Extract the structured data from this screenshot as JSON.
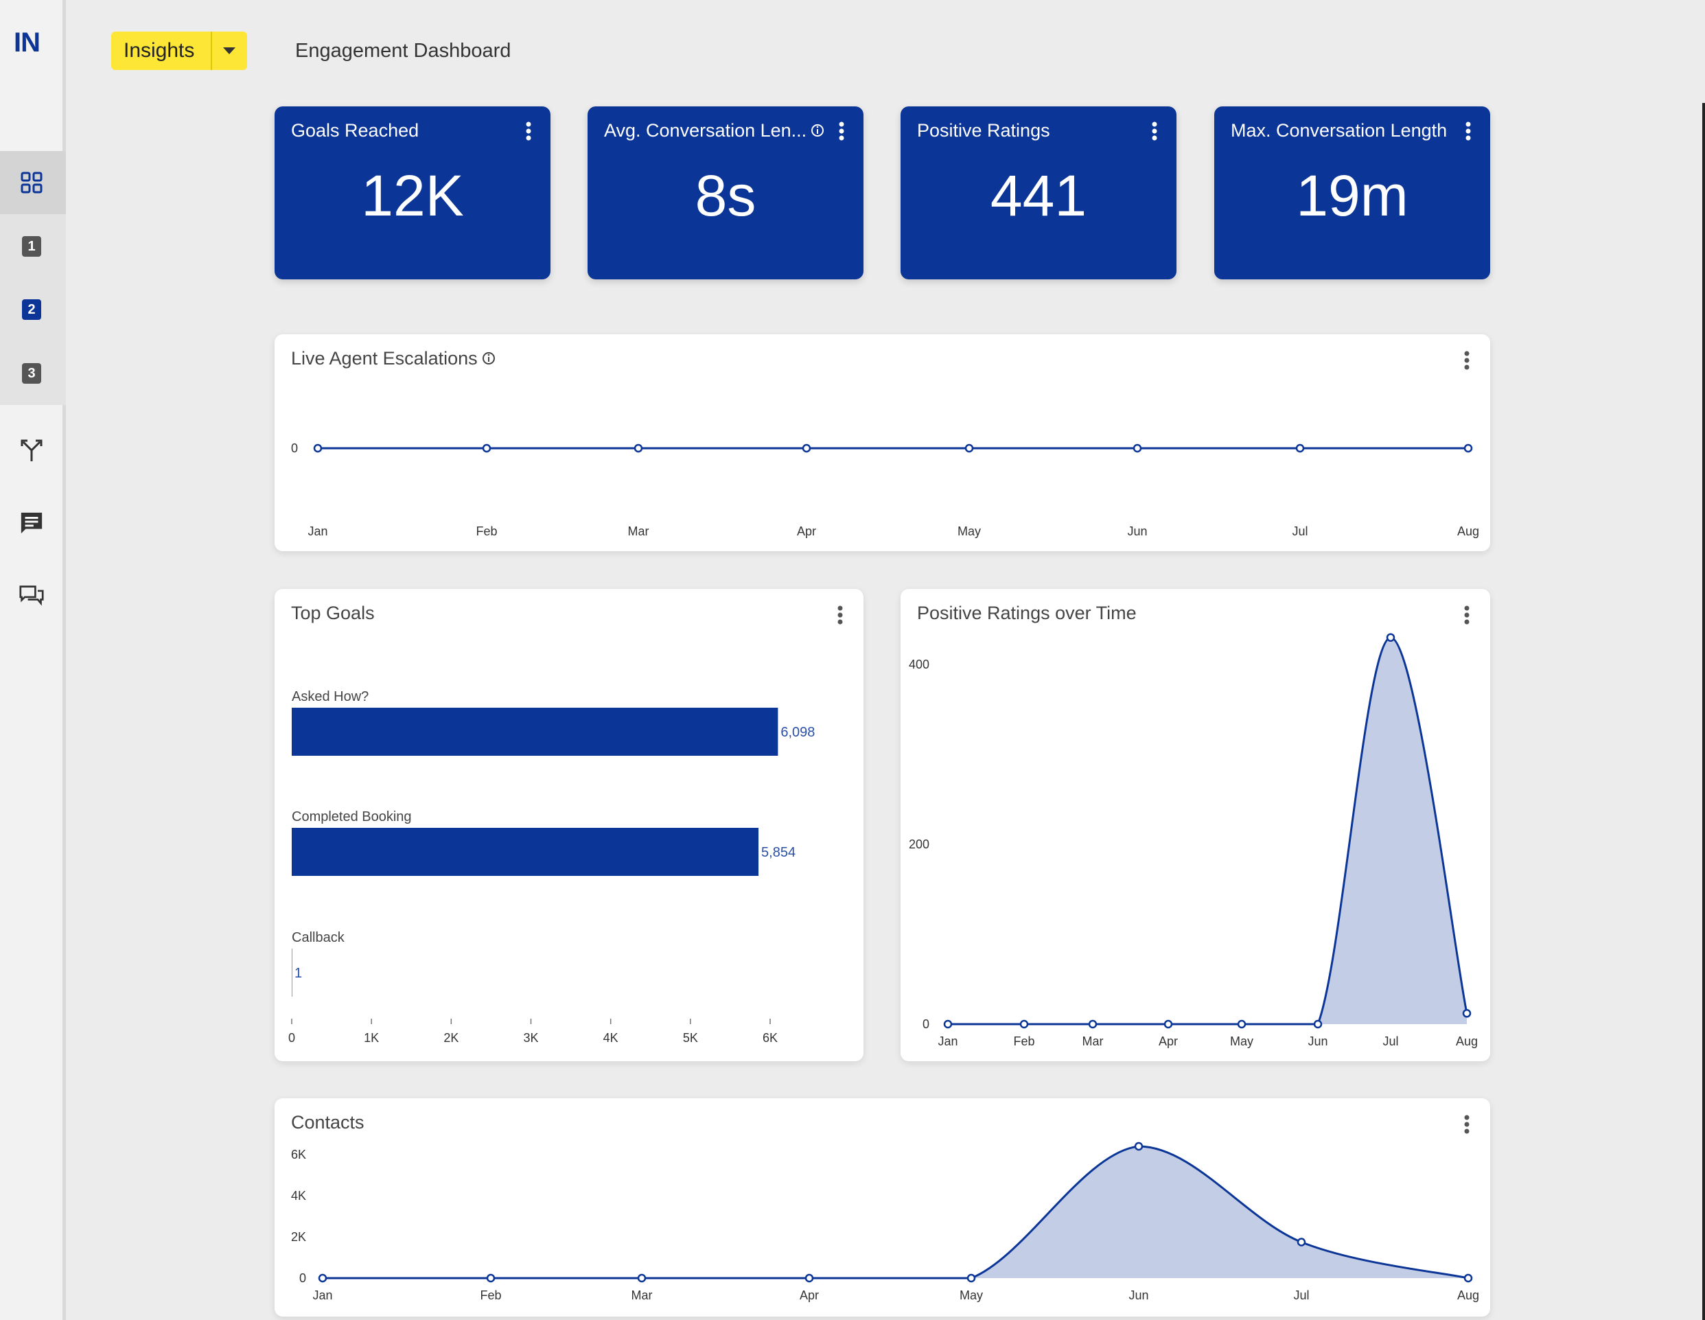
{
  "app": {
    "logo": "IN",
    "section_button": "Insights",
    "page_title": "Engagement Dashboard"
  },
  "sidebar": {
    "icons": [
      "grid-icon",
      "dashboard-1-icon",
      "dashboard-2-icon",
      "dashboard-3-icon",
      "flow-split-icon",
      "message-icon",
      "conversations-icon"
    ],
    "numbered": [
      "1",
      "2",
      "3"
    ]
  },
  "kpis": [
    {
      "title": "Goals Reached",
      "value": "12K"
    },
    {
      "title": "Avg. Conversation Len...",
      "value": "8s"
    },
    {
      "title": "Positive Ratings",
      "value": "441"
    },
    {
      "title": "Max. Conversation Length",
      "value": "19m"
    }
  ],
  "panels": {
    "escalations": {
      "title": "Live Agent Escalations"
    },
    "top_goals": {
      "title": "Top Goals"
    },
    "ratings_over_time": {
      "title": "Positive Ratings over Time"
    },
    "contacts": {
      "title": "Contacts"
    }
  },
  "colors": {
    "brand": "#0b3596",
    "accent_yellow": "#fde636",
    "area_fill": "#c3cde5"
  },
  "chart_data": [
    {
      "id": "escalations",
      "type": "line",
      "title": "Live Agent Escalations",
      "x": [
        "Jan",
        "Feb",
        "Mar",
        "Apr",
        "May",
        "Jun",
        "Jul",
        "Aug"
      ],
      "values": [
        0,
        0,
        0,
        0,
        0,
        0,
        0,
        0
      ],
      "yticks": [
        "0"
      ]
    },
    {
      "id": "top_goals",
      "type": "bar",
      "orientation": "horizontal",
      "title": "Top Goals",
      "categories": [
        "Asked How?",
        "Completed Booking",
        "Callback"
      ],
      "values": [
        6098,
        5854,
        1
      ],
      "value_labels": [
        "6,098",
        "5,854",
        "1"
      ],
      "xticks": [
        "0",
        "1K",
        "2K",
        "3K",
        "4K",
        "5K",
        "6K"
      ],
      "xlim": [
        0,
        6000
      ]
    },
    {
      "id": "ratings_over_time",
      "type": "area",
      "title": "Positive Ratings over Time",
      "x": [
        "Jan",
        "Feb",
        "Mar",
        "Apr",
        "May",
        "Jun",
        "Jul",
        "Aug"
      ],
      "values": [
        0,
        0,
        0,
        0,
        0,
        0,
        430,
        12
      ],
      "yticks": [
        "0",
        "200",
        "400"
      ],
      "ylim": [
        0,
        400
      ]
    },
    {
      "id": "contacts",
      "type": "area",
      "title": "Contacts",
      "x": [
        "Jan",
        "Feb",
        "Mar",
        "Apr",
        "May",
        "Jun",
        "Jul",
        "Aug"
      ],
      "values": [
        0,
        0,
        0,
        0,
        0,
        6400,
        1750,
        0
      ],
      "yticks": [
        "0",
        "2K",
        "4K",
        "6K"
      ],
      "ylim": [
        0,
        6000
      ]
    }
  ]
}
